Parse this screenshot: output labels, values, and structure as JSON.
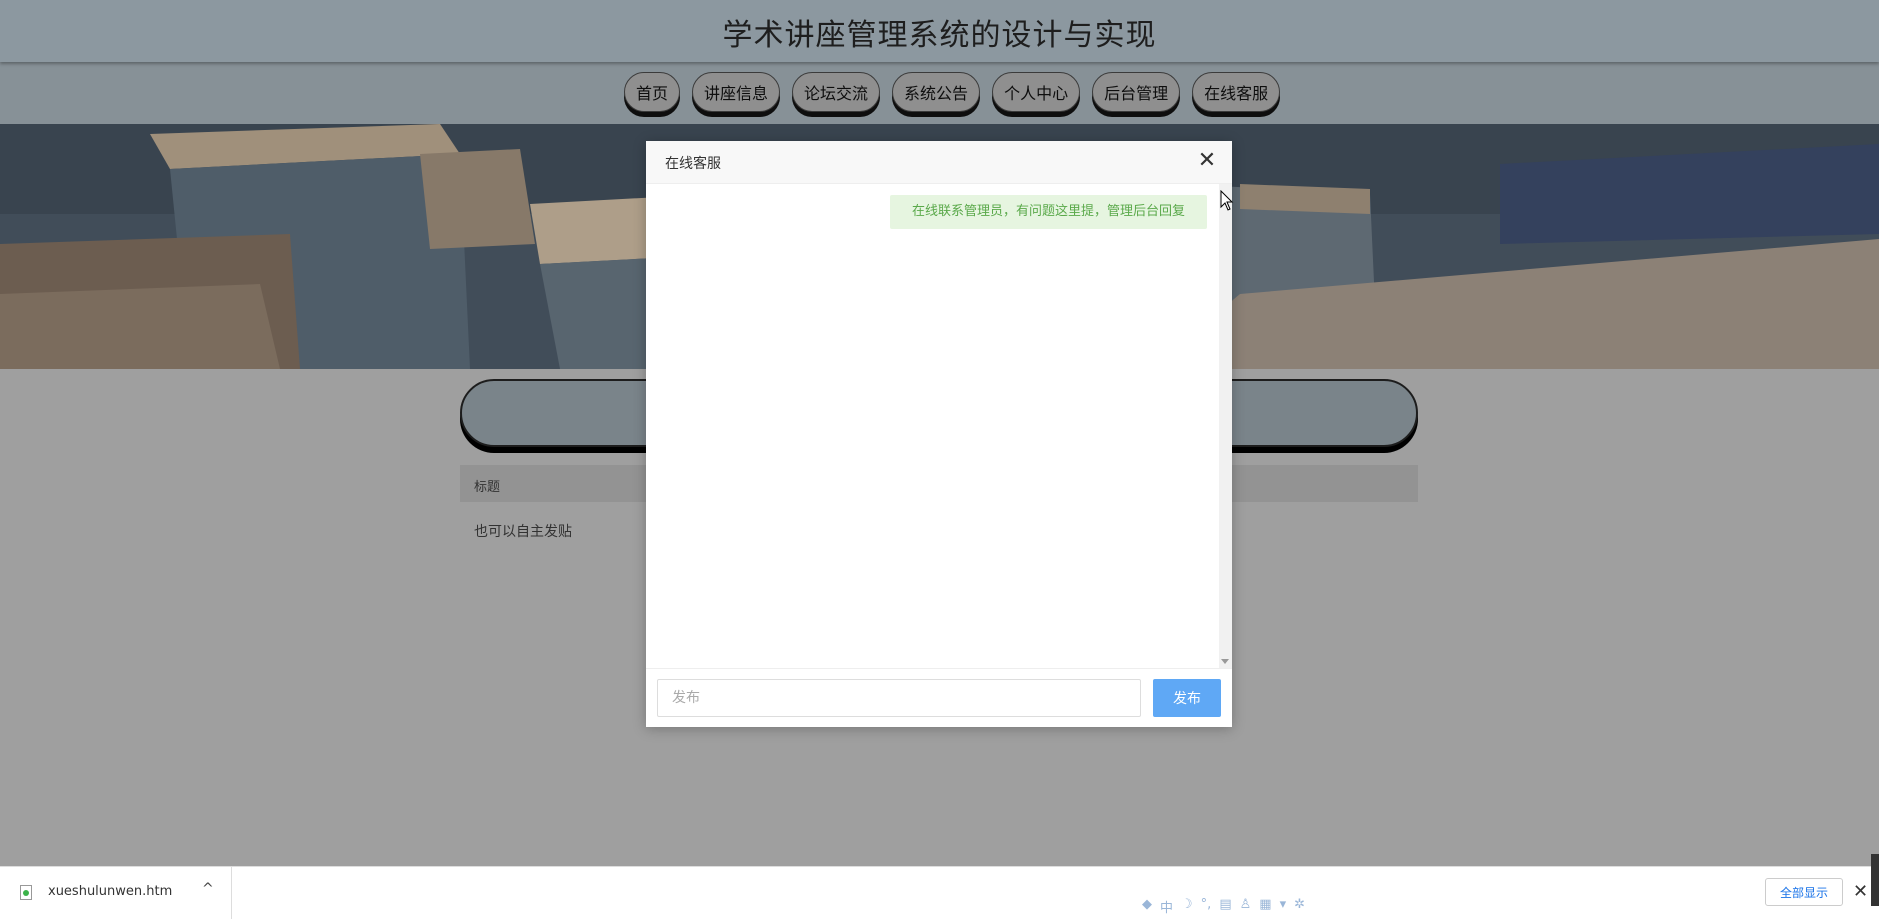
{
  "site": {
    "title": "学术讲座管理系统的设计与实现"
  },
  "nav": {
    "items": [
      "首页",
      "讲座信息",
      "论坛交流",
      "系统公告",
      "个人中心",
      "后台管理",
      "在线客服"
    ]
  },
  "content": {
    "table_header": "标题",
    "row_text": "也可以自主发贴"
  },
  "modal": {
    "title": "在线客服",
    "close_glyph": "✕",
    "message": "在线联系管理员，有问题这里提，管理后台回复",
    "input_placeholder": "发布",
    "submit_label": "发布"
  },
  "download_bar": {
    "file_name": "xueshulunwen.htm",
    "show_all_label": "全部显示",
    "chevron_glyph": "^",
    "close_glyph": "✕"
  },
  "ime": {
    "label": "中"
  },
  "colors": {
    "header_bg": "#8c98a0",
    "send_button": "#5fa8f5",
    "bubble_bg": "#e6f5e0",
    "bubble_text": "#5aa94a"
  }
}
